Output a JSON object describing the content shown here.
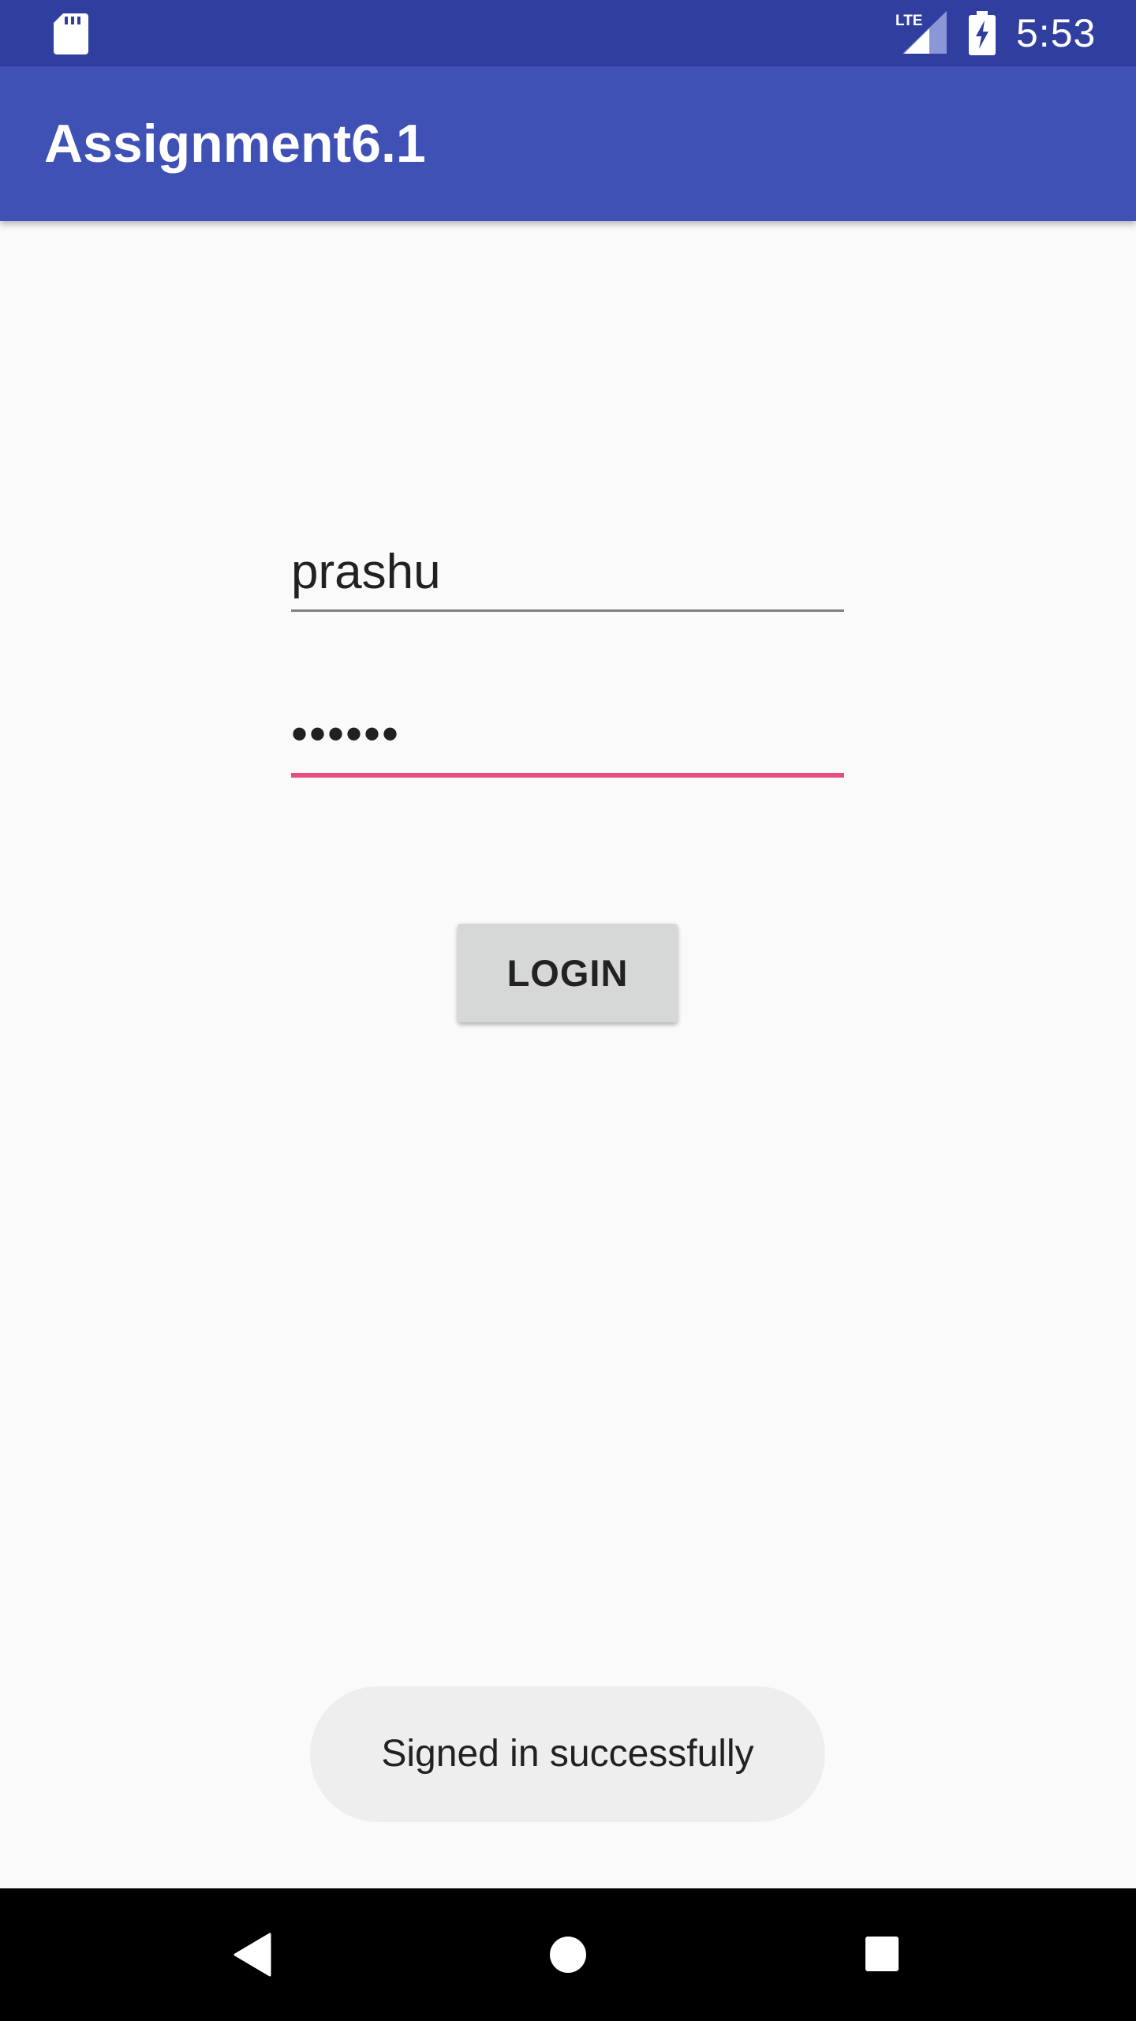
{
  "status_bar": {
    "time": "5:53",
    "network_label": "LTE",
    "icons": [
      "sd-card-icon",
      "lte-signal-icon",
      "battery-charging-icon"
    ],
    "background_color": "#303f9f"
  },
  "app_bar": {
    "title": "Assignment6.1",
    "background_color": "#3f51b5"
  },
  "form": {
    "username_value": "prashu",
    "password_value": "••••••",
    "focused_underline_color": "#e84a82",
    "login_label": "LOGIN"
  },
  "toast": {
    "message": "Signed in successfully"
  },
  "nav_bar": {
    "icons": [
      "back-icon",
      "home-icon",
      "recents-icon"
    ]
  }
}
